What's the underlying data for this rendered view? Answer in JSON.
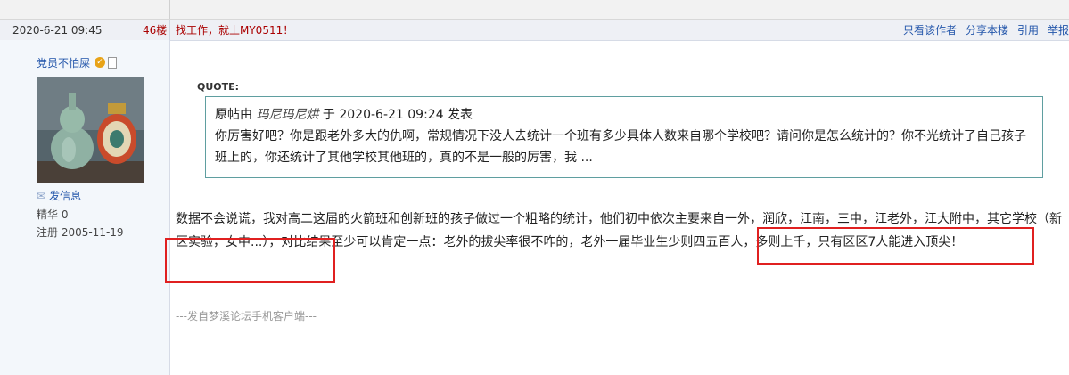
{
  "header": {
    "timestamp": "2020-6-21 09:45",
    "floor": "46楼",
    "ad_text": "找工作，就上MY0511！",
    "actions": [
      "只看该作者",
      "分享本楼",
      "引用",
      "举报"
    ]
  },
  "author": {
    "name": "党员不怕屎",
    "send_message": "发信息",
    "essence": "精华 0",
    "registered": "注册 2005-11-19"
  },
  "quote": {
    "label": "QUOTE:",
    "prefix": "原帖由",
    "author": "玛尼玛尼烘",
    "suffix": "于 2020-6-21 09:24 发表",
    "text": "你厉害好吧？你是跟老外多大的仇啊，常规情况下没人去统计一个班有多少具体人数来自哪个学校吧？请问你是怎么统计的？你不光统计了自己孩子班上的，你还统计了其他学校其他班的，真的不是一般的厉害，我 ..."
  },
  "post": {
    "body": "数据不会说谎，我对高二这届的火箭班和创新班的孩子做过一个粗略的统计，他们初中依次主要来自一外，润欣，江南，三中，江老外，江大附中，其它学校（新区实验，女中...），对比结果至少可以肯定一点：老外的拔尖率很不咋的，老外一届毕业生少则四五百人，多则上千，只有区区7人能进入顶尖！",
    "footer": "---发自梦溪论坛手机客户端---"
  }
}
